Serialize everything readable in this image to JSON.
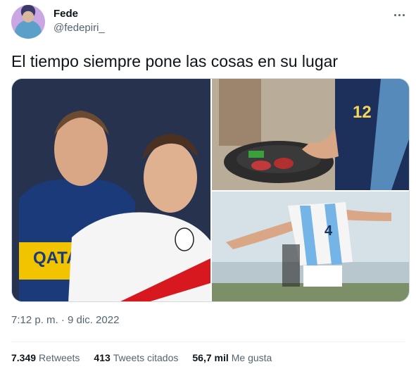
{
  "author": {
    "name": "Fede",
    "handle": "@fedepiri_"
  },
  "tweet": {
    "text": "El tiempo siempre pone las cosas en su lugar",
    "timestamp": "7:12 p. m. · 9 dic. 2022"
  },
  "stats": {
    "retweets_count": "7.349",
    "retweets_label": "Retweets",
    "quotes_count": "413",
    "quotes_label": "Tweets citados",
    "likes_count": "56,7 mil",
    "likes_label": "Me gusta"
  },
  "media": {
    "left_sponsor": "QATAR AIRWAYS",
    "jersey_number_top": "12",
    "jersey_number_bottom": "4"
  },
  "icons": {
    "more": "more-icon"
  }
}
